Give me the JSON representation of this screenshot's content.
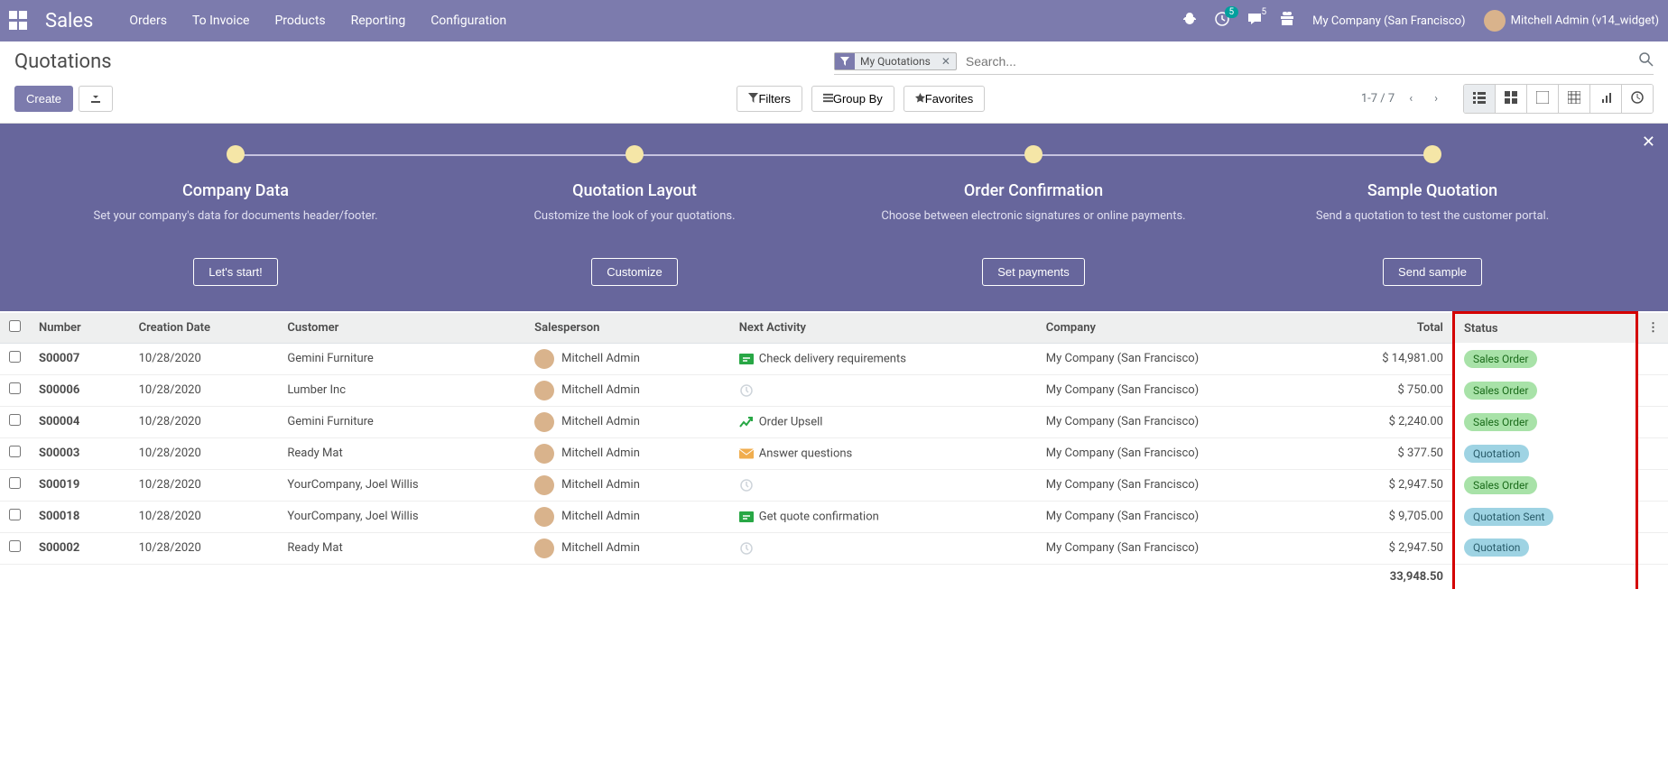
{
  "topnav": {
    "brand": "Sales",
    "menu": [
      "Orders",
      "To Invoice",
      "Products",
      "Reporting",
      "Configuration"
    ],
    "debug_icon": "bug-icon",
    "clock_badge": "5",
    "chat_badge": "5",
    "company": "My Company (San Francisco)",
    "user": "Mitchell Admin (v14_widget)"
  },
  "breadcrumb": "Quotations",
  "search": {
    "facet_label": "My Quotations",
    "placeholder": "Search..."
  },
  "buttons": {
    "create": "Create",
    "filters": "Filters",
    "groupby": "Group By",
    "favorites": "Favorites"
  },
  "pager": "1-7 / 7",
  "banner": {
    "steps": [
      {
        "title": "Company Data",
        "desc": "Set your company's data for documents header/footer.",
        "btn": "Let's start!"
      },
      {
        "title": "Quotation Layout",
        "desc": "Customize the look of your quotations.",
        "btn": "Customize"
      },
      {
        "title": "Order Confirmation",
        "desc": "Choose between electronic signatures or online payments.",
        "btn": "Set payments"
      },
      {
        "title": "Sample Quotation",
        "desc": "Send a quotation to test the customer portal.",
        "btn": "Send sample"
      }
    ]
  },
  "table": {
    "headers": {
      "number": "Number",
      "date": "Creation Date",
      "customer": "Customer",
      "salesperson": "Salesperson",
      "activity": "Next Activity",
      "company": "Company",
      "total": "Total",
      "status": "Status"
    },
    "rows": [
      {
        "number": "S00007",
        "date": "10/28/2020",
        "customer": "Gemini Furniture",
        "salesperson": "Mitchell Admin",
        "activity_type": "todo",
        "activity": "Check delivery requirements",
        "company": "My Company (San Francisco)",
        "total": "$ 14,981.00",
        "status": "Sales Order",
        "status_class": "sales-order"
      },
      {
        "number": "S00006",
        "date": "10/28/2020",
        "customer": "Lumber Inc",
        "salesperson": "Mitchell Admin",
        "activity_type": "none",
        "activity": "",
        "company": "My Company (San Francisco)",
        "total": "$ 750.00",
        "status": "Sales Order",
        "status_class": "sales-order"
      },
      {
        "number": "S00004",
        "date": "10/28/2020",
        "customer": "Gemini Furniture",
        "salesperson": "Mitchell Admin",
        "activity_type": "upsell",
        "activity": "Order Upsell",
        "company": "My Company (San Francisco)",
        "total": "$ 2,240.00",
        "status": "Sales Order",
        "status_class": "sales-order"
      },
      {
        "number": "S00003",
        "date": "10/28/2020",
        "customer": "Ready Mat",
        "salesperson": "Mitchell Admin",
        "activity_type": "mail",
        "activity": "Answer questions",
        "company": "My Company (San Francisco)",
        "total": "$ 377.50",
        "status": "Quotation",
        "status_class": "quotation"
      },
      {
        "number": "S00019",
        "date": "10/28/2020",
        "customer": "YourCompany, Joel Willis",
        "salesperson": "Mitchell Admin",
        "activity_type": "none",
        "activity": "",
        "company": "My Company (San Francisco)",
        "total": "$ 2,947.50",
        "status": "Sales Order",
        "status_class": "sales-order"
      },
      {
        "number": "S00018",
        "date": "10/28/2020",
        "customer": "YourCompany, Joel Willis",
        "salesperson": "Mitchell Admin",
        "activity_type": "todo",
        "activity": "Get quote confirmation",
        "company": "My Company (San Francisco)",
        "total": "$ 9,705.00",
        "status": "Quotation Sent",
        "status_class": "quotation-sent"
      },
      {
        "number": "S00002",
        "date": "10/28/2020",
        "customer": "Ready Mat",
        "salesperson": "Mitchell Admin",
        "activity_type": "none",
        "activity": "",
        "company": "My Company (San Francisco)",
        "total": "$ 2,947.50",
        "status": "Quotation",
        "status_class": "quotation"
      }
    ],
    "footer_total": "33,948.50"
  }
}
